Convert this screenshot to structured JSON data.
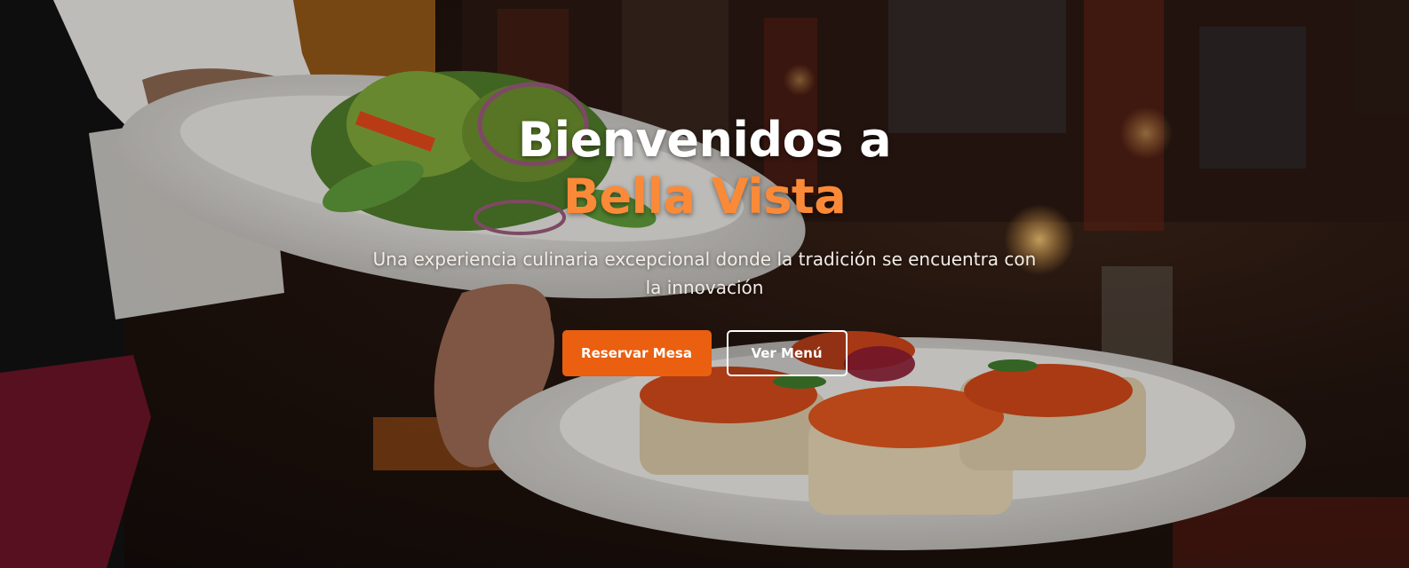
{
  "hero": {
    "title_line1": "Bienvenidos a",
    "title_brand": "Bella Vista",
    "subtitle": "Una experiencia culinaria excepcional donde la tradición se encuentra con la innovación",
    "background_image": "waiter-serving-salad-and-bruschetta-plates"
  },
  "actions": {
    "reserve_label": "Reservar Mesa",
    "menu_label": "Ver Menú"
  },
  "colors": {
    "accent": "#fb8a38",
    "button_primary": "#ea5f10",
    "text": "#ffffff"
  }
}
